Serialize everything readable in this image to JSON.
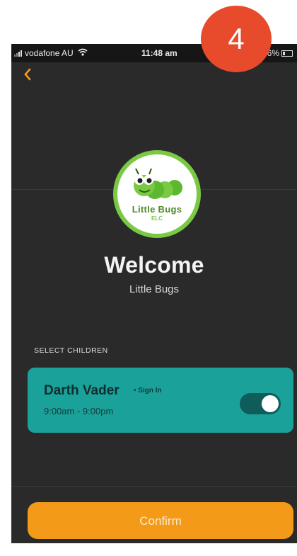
{
  "status_bar": {
    "carrier": "vodafone AU",
    "time": "11:48 am",
    "battery": "6%"
  },
  "icons": {
    "back": "chevron-left-icon",
    "wifi": "wifi-icon",
    "signal": "signal-icon",
    "battery": "battery-icon"
  },
  "logo": {
    "title": "Little Bugs",
    "subtitle": "ELC",
    "colors": {
      "ring": "#7ac943",
      "text": "#4e8a2a"
    }
  },
  "welcome": {
    "heading": "Welcome",
    "centre_name": "Little Bugs"
  },
  "children_section": {
    "label": "SELECT CHILDREN",
    "children": [
      {
        "name": "Darth Vader",
        "action": "• Sign In",
        "time": "9:00am - 9:00pm",
        "selected": true
      }
    ]
  },
  "confirm": {
    "label": "Confirm"
  },
  "step_badge": {
    "number": "4"
  },
  "colors": {
    "background": "#2a2a2b",
    "accent": "#f39a18",
    "card": "#1aa29a",
    "badge": "#e84b2c"
  }
}
